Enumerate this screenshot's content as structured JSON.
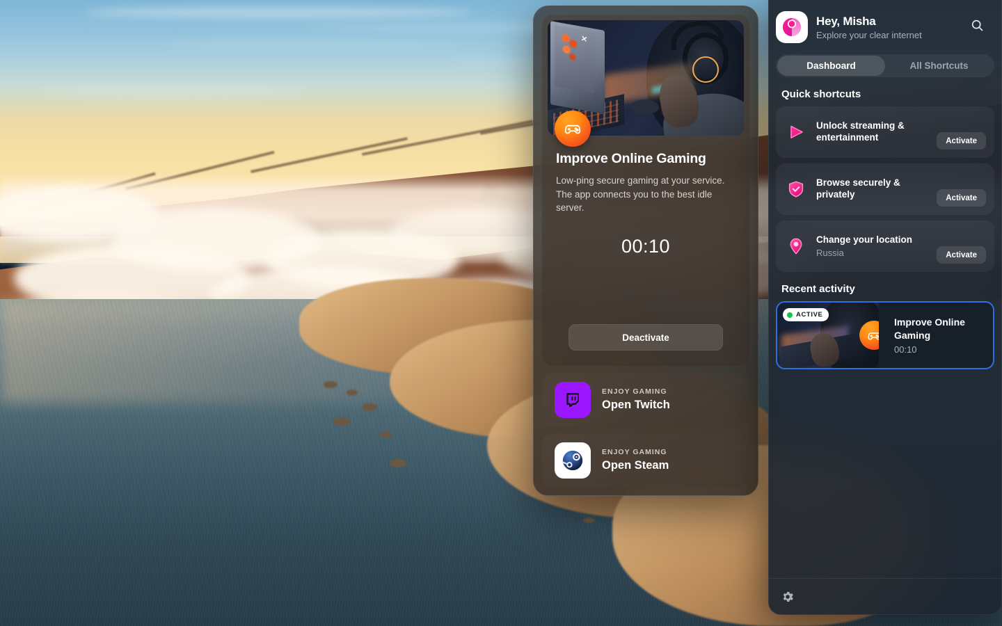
{
  "desktop": {
    "wallpaper_description": "Aerial sunset coastline with mountains above clouds"
  },
  "center_card": {
    "hero": {
      "image_alt": "Gamer wearing headphones at a laptop",
      "badge_icon": "gamepad-icon"
    },
    "title": "Improve Online Gaming",
    "description": "Low-ping secure gaming at your service. The app connects you to the best idle server.",
    "timer": "00:10",
    "action_label": "Deactivate",
    "rows": [
      {
        "kicker": "ENJOY GAMING",
        "title": "Open Twitch",
        "icon": "twitch-icon",
        "icon_bg": "#9b17ff"
      },
      {
        "kicker": "ENJOY GAMING",
        "title": "Open Steam",
        "icon": "steam-icon",
        "icon_bg": "#ffffff"
      }
    ]
  },
  "sidebar": {
    "header": {
      "logo_icon": "app-logo-icon",
      "greeting": "Hey, Misha",
      "subtitle": "Explore your clear internet",
      "search_icon": "search-icon"
    },
    "tabs": [
      {
        "label": "Dashboard",
        "active": true
      },
      {
        "label": "All Shortcuts",
        "active": false
      }
    ],
    "quick_shortcuts": {
      "title": "Quick shortcuts",
      "items": [
        {
          "label": "Unlock streaming & entertainment",
          "value": "",
          "icon": "play-icon",
          "button": "Activate"
        },
        {
          "label": "Browse securely & privately",
          "value": "",
          "icon": "shield-check-icon",
          "button": "Activate"
        },
        {
          "label": "Change your location",
          "value": "Russia",
          "icon": "location-pin-icon",
          "button": "Activate"
        }
      ]
    },
    "recent_activity": {
      "title": "Recent activity",
      "items": [
        {
          "status": "ACTIVE",
          "status_color": "#17c14a",
          "title": "Improve Online Gaming",
          "time": "00:10",
          "badge_icon": "gamepad-icon",
          "selected": true
        }
      ]
    },
    "footer": {
      "settings_icon": "gear-icon"
    }
  },
  "colors": {
    "accent_pink": "#f5218a",
    "accent_orange": "#f6511d",
    "selection_blue": "#2f6fe0",
    "twitch_purple": "#9b17ff",
    "active_green": "#17c14a"
  }
}
